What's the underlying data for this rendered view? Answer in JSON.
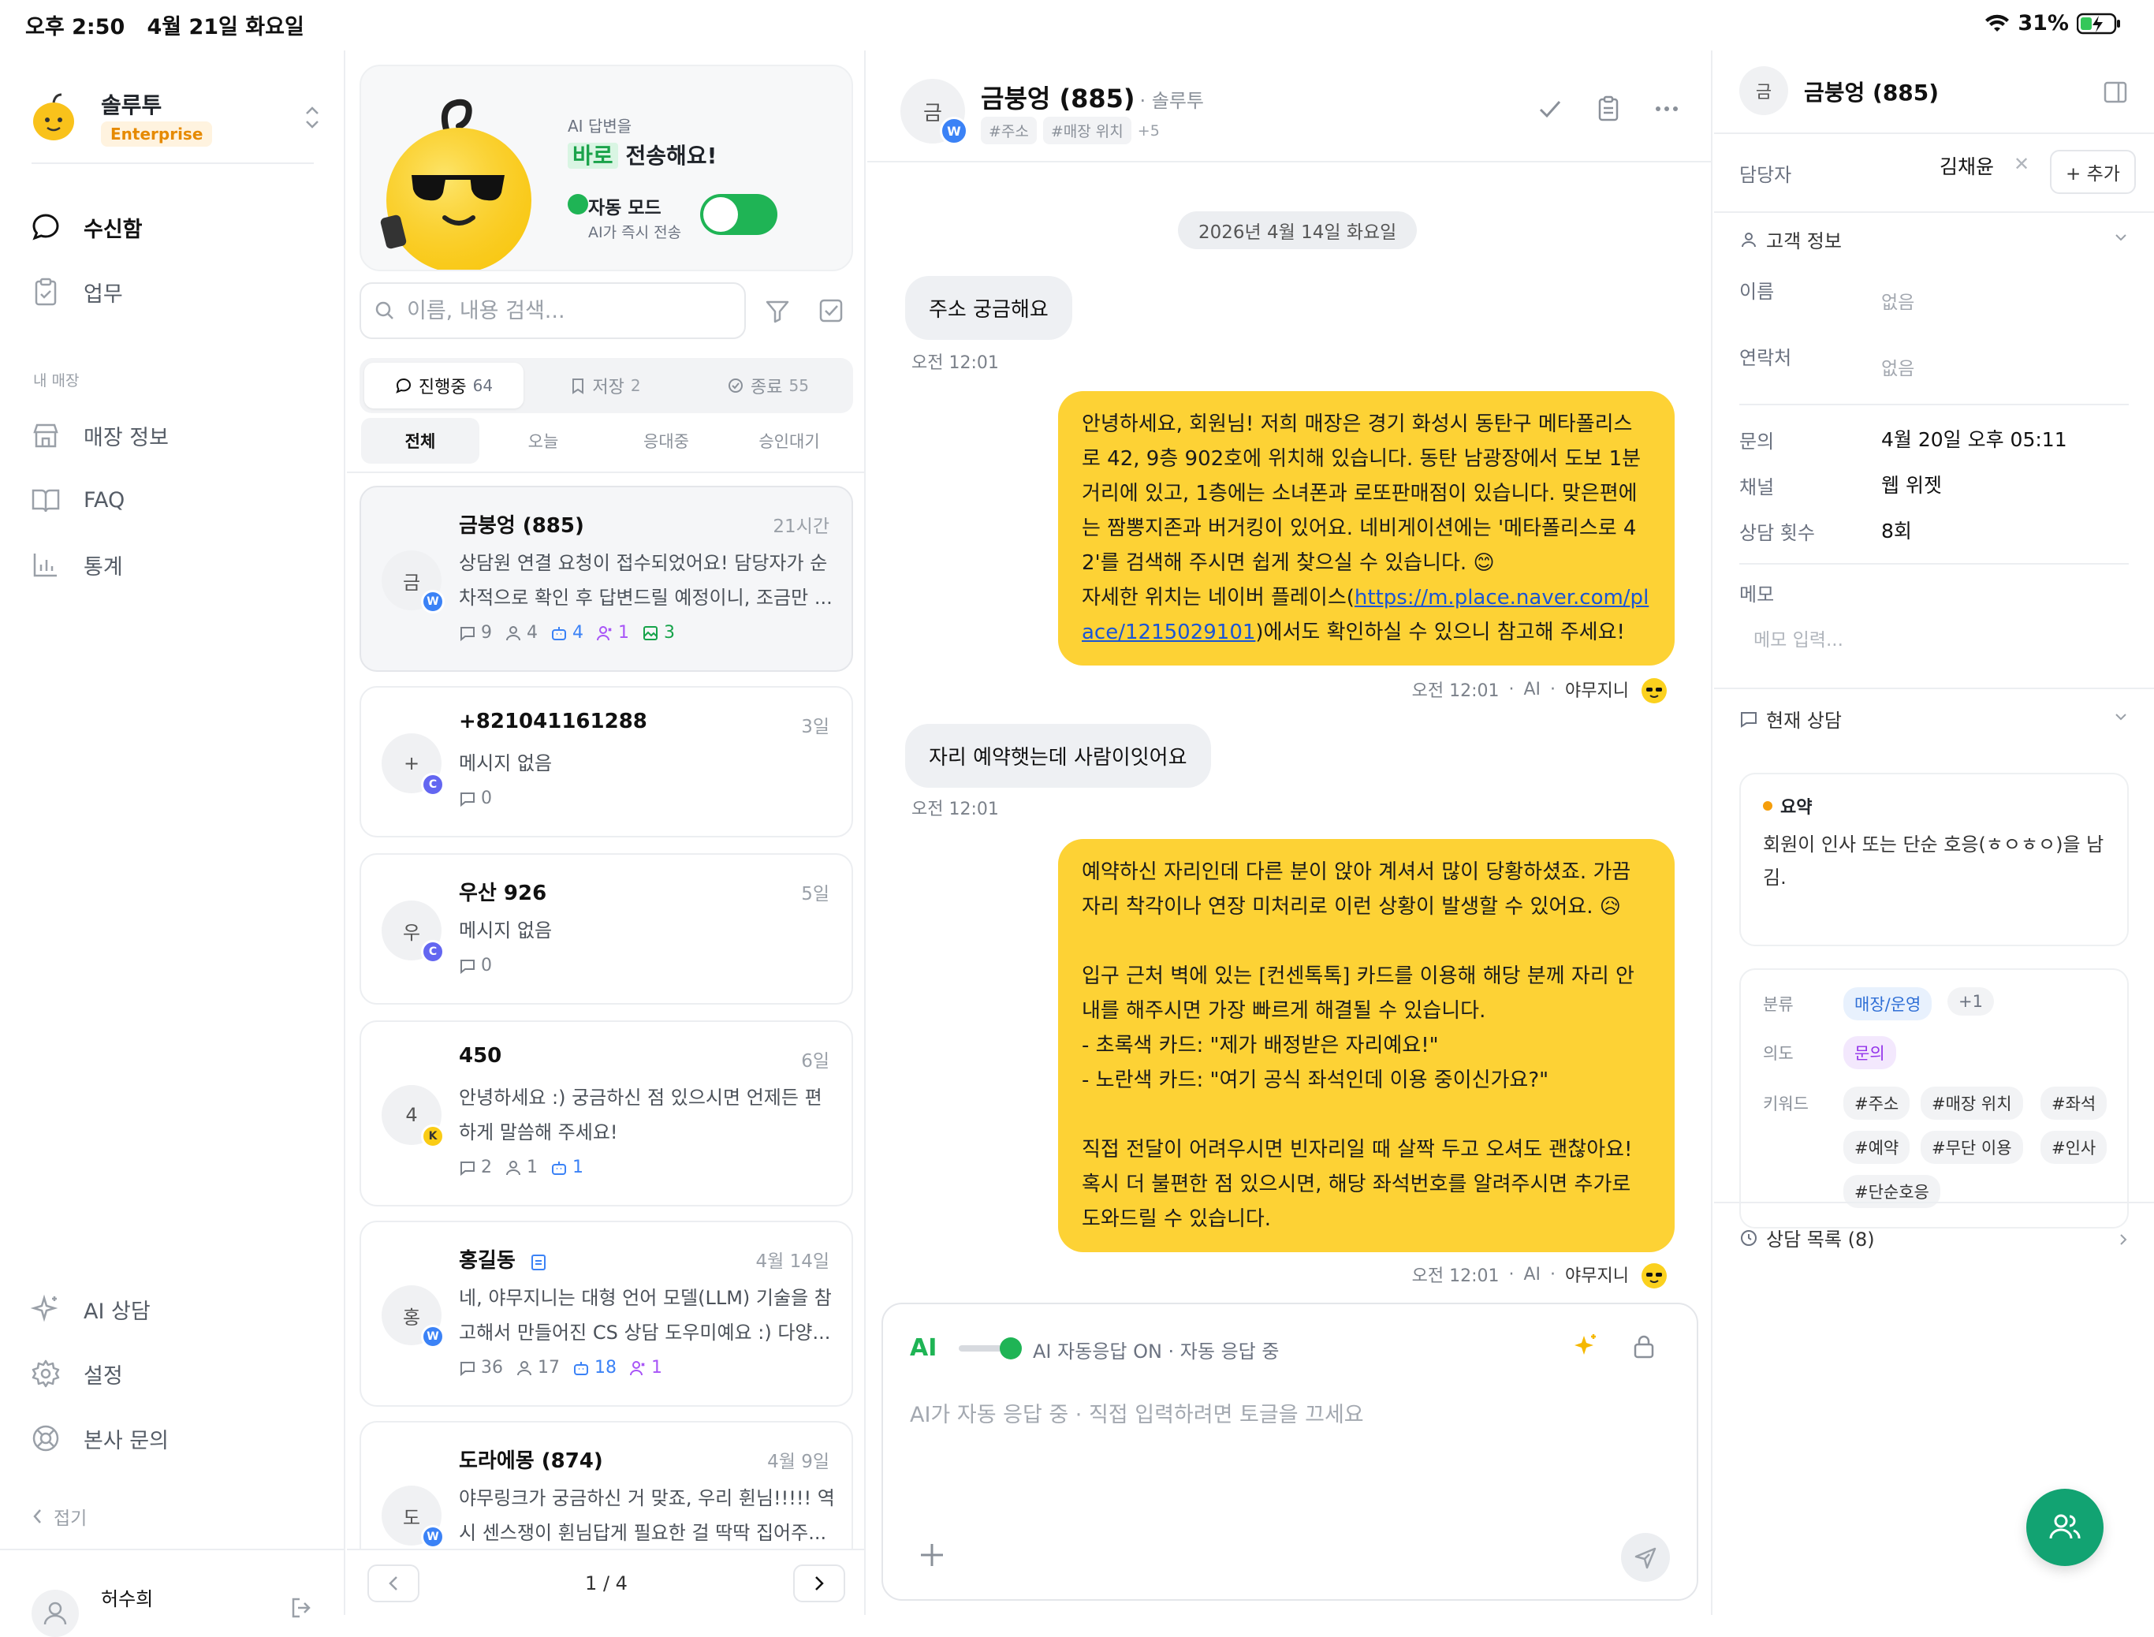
{
  "status_bar": {
    "time": "오후 2:50",
    "date": "4월 21일 화요일",
    "battery": "31%"
  },
  "sidebar": {
    "brand_name": "솔루투",
    "plan": "Enterprise",
    "nav": [
      {
        "label": "수신함",
        "icon": "chat-bubble-icon",
        "active": true
      },
      {
        "label": "업무",
        "icon": "clipboard-icon"
      }
    ],
    "section_label": "내 매장",
    "store_nav": [
      {
        "label": "매장 정보",
        "icon": "store-icon"
      },
      {
        "label": "FAQ",
        "icon": "book-icon"
      },
      {
        "label": "통계",
        "icon": "bar-chart-icon"
      }
    ],
    "bottom_nav": [
      {
        "label": "AI 상담",
        "icon": "sparkle-icon"
      },
      {
        "label": "설정",
        "icon": "gear-icon"
      },
      {
        "label": "본사 문의",
        "icon": "lifebuoy-icon"
      }
    ],
    "collapse_label": "접기",
    "user_name": "허수희"
  },
  "list": {
    "promo": {
      "line1": "AI 답변을",
      "highlight": "바로",
      "line2": "전송해요!",
      "mode_title": "자동 모드",
      "mode_sub": "AI가 즉시 전송",
      "toggle_on": true
    },
    "search_placeholder": "이름, 내용 검색...",
    "tabs": [
      {
        "label": "진행중",
        "count": "64",
        "active": true
      },
      {
        "label": "저장",
        "count": "2"
      },
      {
        "label": "종료",
        "count": "55"
      }
    ],
    "subtabs": [
      "전체",
      "오늘",
      "응대중",
      "승인대기"
    ],
    "conversations": [
      {
        "initial": "금",
        "badge": "W",
        "badge_color": "#3b82f6",
        "name": "금붕엉 (885)",
        "time": "21시간",
        "preview": "상담원 연결 요청이 접수되었어요! 담당자가 순차적으로 확인 후 답변드릴 예정이니, 조금만 ...",
        "stats": {
          "msgs": "9",
          "people": "4",
          "bot": "4",
          "agent": "1",
          "image": "3"
        }
      },
      {
        "initial": "+",
        "badge": "C",
        "badge_color": "#6366f1",
        "name": "+821041161288",
        "time": "3일",
        "preview": "메시지 없음",
        "stats": {
          "msgs": "0"
        }
      },
      {
        "initial": "우",
        "badge": "C",
        "badge_color": "#6366f1",
        "name": "우산 926",
        "time": "5일",
        "preview": "메시지 없음",
        "stats": {
          "msgs": "0"
        }
      },
      {
        "initial": "4",
        "badge": "K",
        "badge_color": "#facc15",
        "name": "450",
        "time": "6일",
        "preview": "안녕하세요 :) 궁금하신 점 있으시면 언제든 편하게 말씀해 주세요!",
        "stats": {
          "msgs": "2",
          "people": "1",
          "bot": "1"
        }
      },
      {
        "initial": "홍",
        "badge": "W",
        "badge_color": "#3b82f6",
        "name": "홍길동",
        "time": "4월 14일",
        "preview": "네, 야무지니는 대형 언어 모델(LLM) 기술을 참고해서 만들어진 CS 상담 도우미예요 :) 다양...",
        "stats": {
          "msgs": "36",
          "people": "17",
          "bot": "18",
          "agent": "1"
        }
      },
      {
        "initial": "도",
        "badge": "W",
        "badge_color": "#3b82f6",
        "name": "도라에몽 (874)",
        "time": "4월 9일",
        "preview": "야무링크가 궁금하신 거 맞죠, 우리 휜님!!!!! 역시 센스쟁이 휜님답게 필요한 걸 딱딱 집어주..."
      }
    ],
    "page": "1 / 4"
  },
  "chat": {
    "initial": "금",
    "badge": "W",
    "name": "금붕엉 (885)",
    "org": "· 솔루투",
    "tags": [
      "#주소",
      "#매장 위치"
    ],
    "more_tags": "+5",
    "date_divider": "2026년 4월 14일 화요일",
    "messages": [
      {
        "dir": "in",
        "text": "주소 궁금해요",
        "time": "오전 12:01"
      },
      {
        "dir": "out",
        "text_a": "안녕하세요, 회원님! 저희 매장은 경기 화성시 동탄구 메타폴리스로 42, 9층 902호에 위치해 있습니다. 동탄 남광장에서 도보 1분 거리에 있고, 1층에는 소녀폰과 로또판매점이 있습니다. 맞은편에는 짬뽕지존과 버거킹이 있어요. 네비게이션에는 '메타폴리스로 42'를 검색해 주시면 쉽게 찾으실 수 있습니다. 😊\n자세한 위치는 네이버 플레이스(",
        "link": "https://m.place.naver.com/place/1215029101",
        "text_b": ")에서도 확인하실 수 있으니 참고해 주세요!",
        "time": "오전 12:01",
        "via": "AI",
        "sender": "야무지니"
      },
      {
        "dir": "in",
        "text": "자리 예약햇는데 사람이잇어요",
        "time": "오전 12:01"
      },
      {
        "dir": "out",
        "text": "예약하신 자리인데 다른 분이 앉아 계셔서 많이 당황하셨죠. 가끔 자리 착각이나 연장 미처리로 이런 상황이 발생할 수 있어요. 😥\n\n입구 근처 벽에 있는 [컨센톡톡] 카드를 이용해 해당 분께 자리 안내를 해주시면 가장 빠르게 해결될 수 있습니다.\n- 초록색 카드: \"제가 배정받은 자리예요!\"\n- 노란색 카드: \"여기 공식 좌석인데 이용 중이신가요?\"\n\n직접 전달이 어려우시면 빈자리일 때 살짝 두고 오셔도 괜찮아요!\n혹시 더 불편한 점 있으시면, 해당 좌석번호를 알려주시면 추가로 도와드릴 수 있습니다.",
        "time": "오전 12:01",
        "via": "AI",
        "sender": "야무지니"
      }
    ],
    "composer": {
      "ai_label": "AI",
      "status": "AI 자동응답 ON · 자동 응답 중",
      "placeholder": "AI가 자동 응답 중 · 직접 입력하려면 토글을 끄세요"
    }
  },
  "detail": {
    "initial": "금",
    "name": "금붕엉 (885)",
    "assignee_label": "담당자",
    "assignee": "김채윤",
    "add_label": "+ 추가",
    "customer_section": "고객 정보",
    "fields": [
      {
        "label": "이름",
        "value": "없음"
      },
      {
        "label": "연락처",
        "value": "없음"
      }
    ],
    "meta": [
      {
        "label": "문의",
        "value": "4월 20일 오후 05:11"
      },
      {
        "label": "채널",
        "value": "웹 위젯"
      },
      {
        "label": "상담 횟수",
        "value": "8회"
      }
    ],
    "memo_label": "메모",
    "memo_placeholder": "메모 입력...",
    "current_section": "현재 상담",
    "summary_title": "요약",
    "summary": "회원이 인사 또는 단순 호응(ㅎㅇㅎㅇ)을 남김.",
    "category_label": "분류",
    "category": "매장/운영",
    "category_more": "+1",
    "intent_label": "의도",
    "intent": "문의",
    "keywords_label": "키워드",
    "keywords": [
      "#주소",
      "#매장 위치",
      "#좌석",
      "#예약",
      "#무단 이용",
      "#인사",
      "#단순호응"
    ],
    "history": "상담 목록 (8)"
  }
}
